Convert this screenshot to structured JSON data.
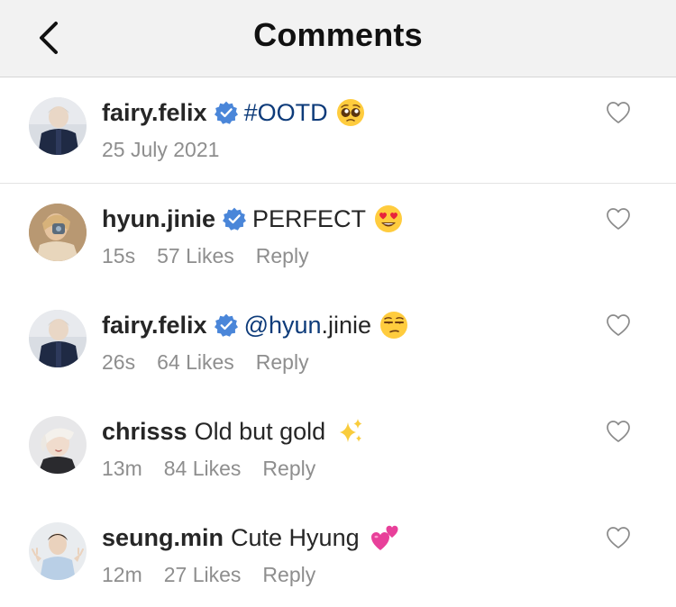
{
  "header": {
    "title": "Comments"
  },
  "caption": {
    "username": "fairy.felix",
    "verified": true,
    "text": "#OOTD",
    "emoji": "pleading-face",
    "date": "25 July 2021"
  },
  "comments": [
    {
      "username": "hyun.jinie",
      "verified": true,
      "mention": "",
      "text": "PERFECT",
      "emoji": "heart-eyes",
      "time": "15s",
      "likes": "57 Likes",
      "reply": "Reply"
    },
    {
      "username": "fairy.felix",
      "verified": true,
      "mention_link": "@hyun",
      "mention_rest": ".jinie",
      "text": "",
      "emoji": "unamused-face",
      "time": "26s",
      "likes": "64 Likes",
      "reply": "Reply"
    },
    {
      "username": "chrisss",
      "verified": false,
      "text": "Old but gold",
      "emoji": "sparkles",
      "time": "13m",
      "likes": "84 Likes",
      "reply": "Reply"
    },
    {
      "username": "seung.min",
      "verified": false,
      "text": "Cute Hyung",
      "emoji": "two-hearts",
      "time": "12m",
      "likes": "27 Likes",
      "reply": "Reply"
    }
  ],
  "colors": {
    "verified_badge": "#3897f0",
    "hashtag": "#0d3b7a",
    "meta_text": "#8e8e8e",
    "header_bg": "#f2f2f2"
  }
}
